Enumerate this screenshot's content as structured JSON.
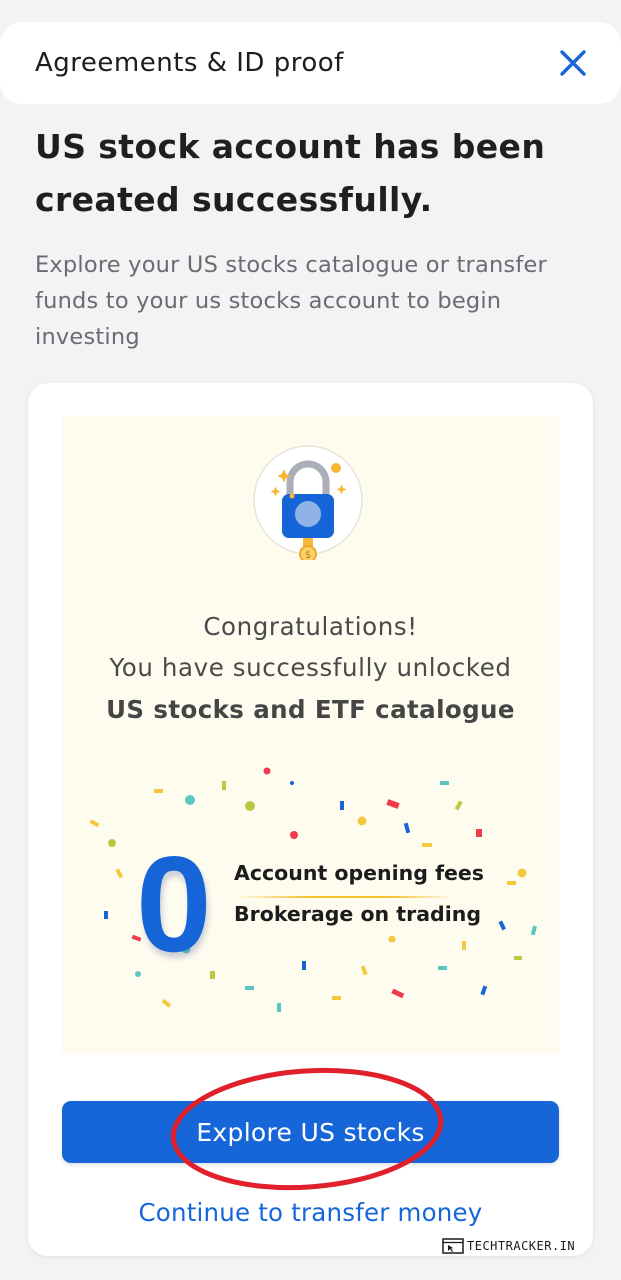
{
  "header": {
    "title": "Agreements & ID proof",
    "close_icon": "close-icon"
  },
  "main": {
    "headline": "US stock account has been created successfully.",
    "subtext": "Explore your US stocks catalogue or transfer funds to your us stocks account to begin investing"
  },
  "card": {
    "illustration_icon": "padlock-icon",
    "congrats": "Congratulations!",
    "unlocked_text": "You have successfully unlocked",
    "catalogue_text": "US stocks and ETF catalogue",
    "zero_value": "0",
    "fee_line_1": "Account opening fees",
    "fee_line_2": "Brokerage on trading",
    "explore_button": "Explore US stocks",
    "transfer_link": "Continue to transfer money"
  },
  "watermark": {
    "text": "TECHTRACKER.IN"
  },
  "colors": {
    "accent_blue": "#1766d9",
    "highlight_red": "#e0202a",
    "promo_bg": "#fefcef",
    "page_bg": "#f3f3f6"
  }
}
